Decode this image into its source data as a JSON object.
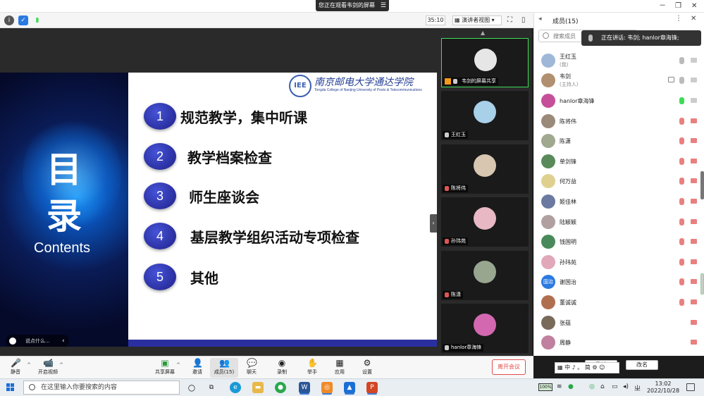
{
  "window": {
    "viewing_banner": "您正在观看韦剑的屏幕",
    "controls": [
      "－",
      "❐",
      "✕"
    ]
  },
  "topbar": {
    "timer": "35:10",
    "view_mode": "演讲者视图"
  },
  "slide": {
    "title_char_1": "目",
    "title_char_2": "录",
    "title_en": "Contents",
    "logo_mark": "IEE",
    "logo_name": "南京邮电大学通达学院",
    "logo_sub": "Tongda College of Nanjing University of Posts & Telecommunications",
    "comment_placeholder": "说点什么...",
    "agenda": [
      {
        "num": "1",
        "text": "规范教学，集中听课"
      },
      {
        "num": "2",
        "text": "教学档案检查"
      },
      {
        "num": "3",
        "text": "师生座谈会"
      },
      {
        "num": "4",
        "text": "基层教学组织活动专项检查"
      },
      {
        "num": "5",
        "text": "其他"
      }
    ]
  },
  "gallery": {
    "share_tile": "韦剑的屏幕共享",
    "tiles": [
      {
        "name": "王红玉",
        "muted": false,
        "color": "#a8d0e8"
      },
      {
        "name": "陈将伟",
        "muted": true,
        "color": "#d8c6b0"
      },
      {
        "name": "孙玮苑",
        "muted": true,
        "color": "#e8b8c4"
      },
      {
        "name": "陈潇",
        "muted": true,
        "color": "#98a690"
      },
      {
        "name": "hanlor章海锋",
        "muted": false,
        "color": "#d468b0"
      }
    ]
  },
  "panel": {
    "title": "成员(15)",
    "search_placeholder": "搜索成员",
    "speaking": "正在讲话: 韦剑; hanlor章海锋;",
    "members": [
      {
        "name": "王红玉",
        "role": "(我)",
        "mic": "on",
        "cam": "on",
        "color": "#9fb8d8"
      },
      {
        "name": "韦剑",
        "role": "(主持人)",
        "mic": "on",
        "cam": "on",
        "color": "#b09070"
      },
      {
        "name": "hanlor章海锋",
        "role": "",
        "mic": "live",
        "cam": "on",
        "color": "#c64f9a"
      },
      {
        "name": "陈将伟",
        "role": "",
        "mic": "muted",
        "cam": "muted",
        "color": "#9a8a7a"
      },
      {
        "name": "陈潇",
        "role": "",
        "mic": "muted",
        "cam": "muted",
        "color": "#a0a890"
      },
      {
        "name": "单剑锋",
        "role": "",
        "mic": "muted",
        "cam": "muted",
        "color": "#5a8a5a"
      },
      {
        "name": "何万益",
        "role": "",
        "mic": "muted",
        "cam": "muted",
        "color": "#e0d090"
      },
      {
        "name": "姬佳林",
        "role": "",
        "mic": "muted",
        "cam": "muted",
        "color": "#6a7aa0"
      },
      {
        "name": "陆颖颖",
        "role": "",
        "mic": "muted",
        "cam": "muted",
        "color": "#b0a0a0"
      },
      {
        "name": "钱国明",
        "role": "",
        "mic": "muted",
        "cam": "muted",
        "color": "#4a8a5a"
      },
      {
        "name": "孙玮苑",
        "role": "",
        "mic": "muted",
        "cam": "muted",
        "color": "#e0a8b8"
      },
      {
        "name": "谢国治",
        "role": "",
        "mic": "muted",
        "cam": "muted",
        "color": "#2a7ae0",
        "initials": "国治"
      },
      {
        "name": "董诚诚",
        "role": "",
        "mic": "muted",
        "cam": "muted",
        "color": "#b07050"
      },
      {
        "name": "张蕴",
        "role": "",
        "mic": "",
        "cam": "muted",
        "color": "#7a6a5a"
      },
      {
        "name": "周静",
        "role": "",
        "mic": "",
        "cam": "muted",
        "color": "#c080a0"
      }
    ],
    "invite": "邀请",
    "rename": "改名"
  },
  "toolbar": {
    "items": [
      {
        "label": "静音",
        "icon": "🎤"
      },
      {
        "label": "开启视频",
        "icon": "📹"
      },
      {
        "label": "共享屏幕",
        "icon": "▣"
      },
      {
        "label": "邀请",
        "icon": "👤"
      },
      {
        "label": "成员(15)",
        "icon": "👥"
      },
      {
        "label": "聊天",
        "icon": "💬"
      },
      {
        "label": "录制",
        "icon": "◉"
      },
      {
        "label": "举手",
        "icon": "✋"
      },
      {
        "label": "应用",
        "icon": "▦"
      },
      {
        "label": "设置",
        "icon": "⚙"
      }
    ],
    "leave": "离开会议"
  },
  "ime": "中 ♪ 。 简 ⚙ ☺",
  "taskbar": {
    "search_placeholder": "在这里输入你要搜索的内容",
    "battery": "100%",
    "time": "13:02",
    "date": "2022/10/28"
  },
  "colors": {
    "accent": "#2a2fa0",
    "live_mic": "#3ddc55",
    "leave": "#e34b4b"
  }
}
